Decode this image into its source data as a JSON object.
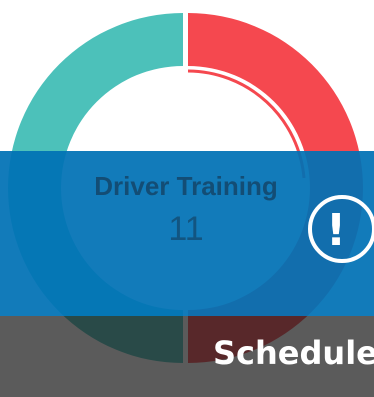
{
  "widget": {
    "title": "Driver Training",
    "count": "11"
  },
  "alert": {
    "icon": "exclamation-circle-icon",
    "glyph": "!"
  },
  "footer": {
    "label": "Schedule"
  },
  "colors": {
    "segment_teal": "#4cc1ba",
    "segment_red": "#f5484f",
    "banner_blue": "#0071b5",
    "footer_dark": "#1c1c1c"
  }
}
